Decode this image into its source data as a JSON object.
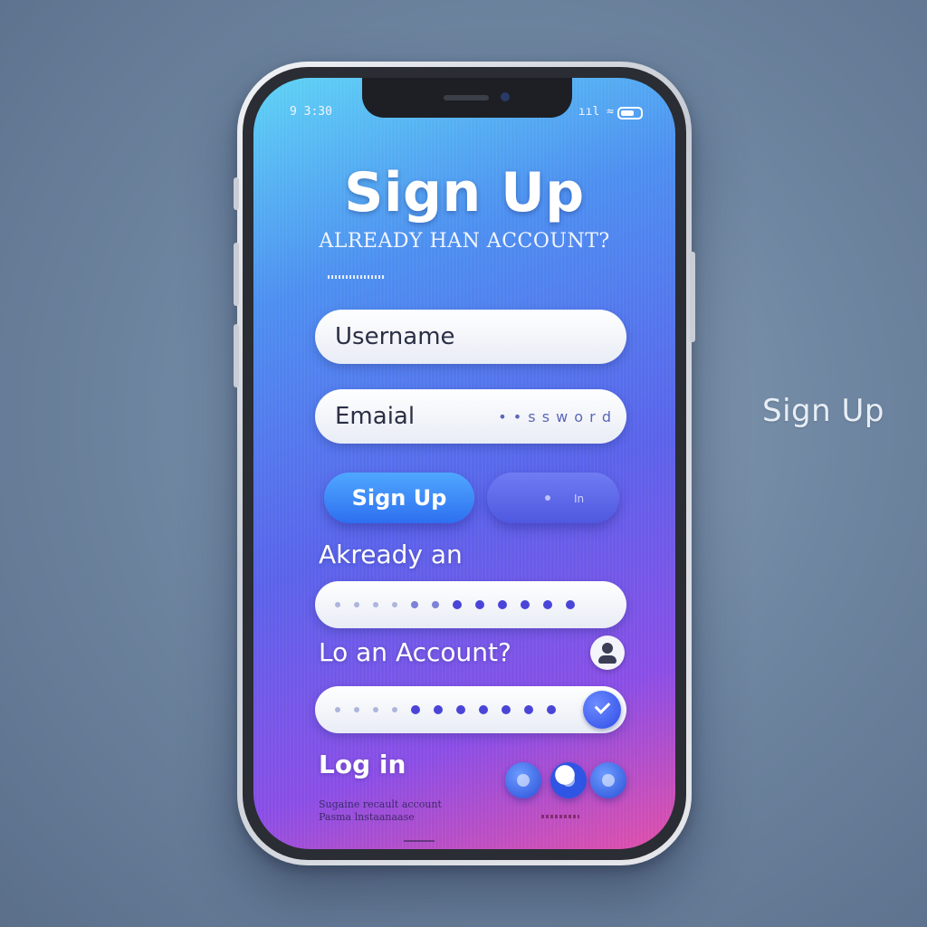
{
  "side_label": "Sign Up",
  "status_bar": {
    "left": "9 3:30",
    "right": "ııl ≈"
  },
  "title": "Sign Up",
  "subtitle": "ALREADY HAN ACCOUNT?",
  "form": {
    "username_label": "Username",
    "email_label": "Emaial",
    "email_hint": "• • s s w o r d"
  },
  "buttons": {
    "primary_label": "Sign Up",
    "secondary_label": "In"
  },
  "labels": {
    "already": "Akready an",
    "login_prompt": "Lo an Account?",
    "login": "Log in"
  },
  "footer": {
    "line1": "Sugaine recault account",
    "line2": "Pasma lnstaanaase"
  },
  "colors": {
    "accent": "#2e6ff0",
    "gradient_start": "#5fd3f5",
    "gradient_end": "#e24fa8"
  }
}
